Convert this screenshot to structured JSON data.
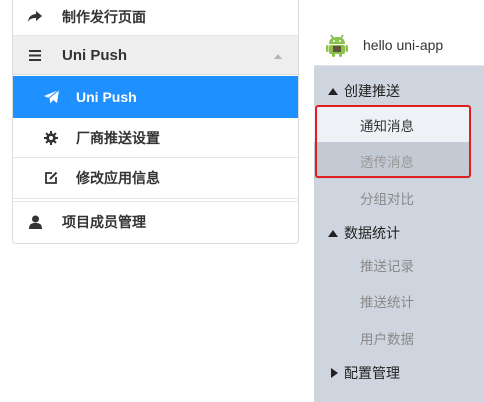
{
  "left_menu": {
    "publish_label": "制作发行页面",
    "unipush_group_label": "Uni Push",
    "unipush_item_label": "Uni Push",
    "vendor_label": "厂商推送设置",
    "modify_label": "修改应用信息",
    "members_label": "项目成员管理"
  },
  "right_panel": {
    "app_title": "hello uni-app",
    "groups": {
      "create_push": "创建推送",
      "data_stats": "数据统计",
      "config": "配置管理"
    },
    "items": {
      "notification": "通知消息",
      "passthrough": "透传消息",
      "group_compare": "分组对比",
      "push_records": "推送记录",
      "push_stats": "推送统计",
      "user_data": "用户数据"
    }
  },
  "colors": {
    "active_blue": "#1e90ff",
    "highlight_red": "#e02020",
    "menu_bg": "#cfd5de"
  },
  "icons": [
    "share-arrow-icon",
    "hamburger-icon",
    "send-plane-icon",
    "gear-icon",
    "edit-icon",
    "user-icon",
    "android-logo-icon"
  ]
}
